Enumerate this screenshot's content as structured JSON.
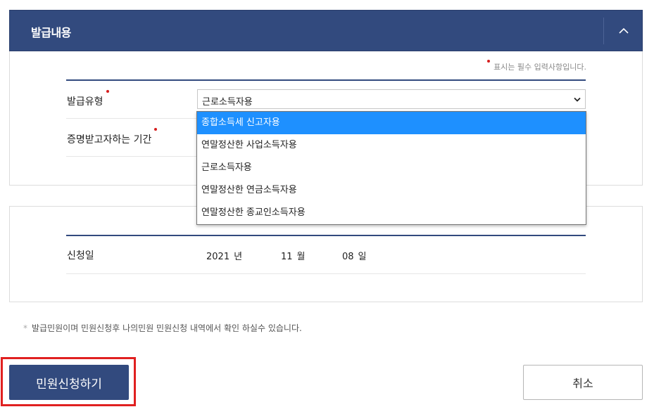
{
  "panel": {
    "title": "발급내용",
    "collapse_icon": "chevron-up-icon"
  },
  "required_note": "표시는 필수 입력사항입니다.",
  "form": {
    "issue_type_label": "발급유형",
    "issue_type_value": "근로소득자용",
    "period_label": "증명받고자하는 기간",
    "options": [
      "종합소득세 신고자용",
      "연말정산한 사업소득자용",
      "근로소득자용",
      "연말정산한 연금소득자용",
      "연말정산한 종교인소득자용"
    ],
    "highlighted_option": "종합소득세 신고자용"
  },
  "application": {
    "date_label": "신청일",
    "year": "2021",
    "year_unit": "년",
    "month": "11",
    "month_unit": "월",
    "day": "08",
    "day_unit": "일"
  },
  "footnote": {
    "bullet": "*",
    "text": "발급민원이며 민원신청후 나의민원 민원신청 내역에서 확인 하실수 있습니다."
  },
  "buttons": {
    "apply": "민원신청하기",
    "cancel": "취소"
  },
  "colors": {
    "brand": "#324a7e",
    "required_dot": "#d61e1e",
    "highlight_option": "#1e90ff",
    "annotation_box": "#e02020"
  }
}
